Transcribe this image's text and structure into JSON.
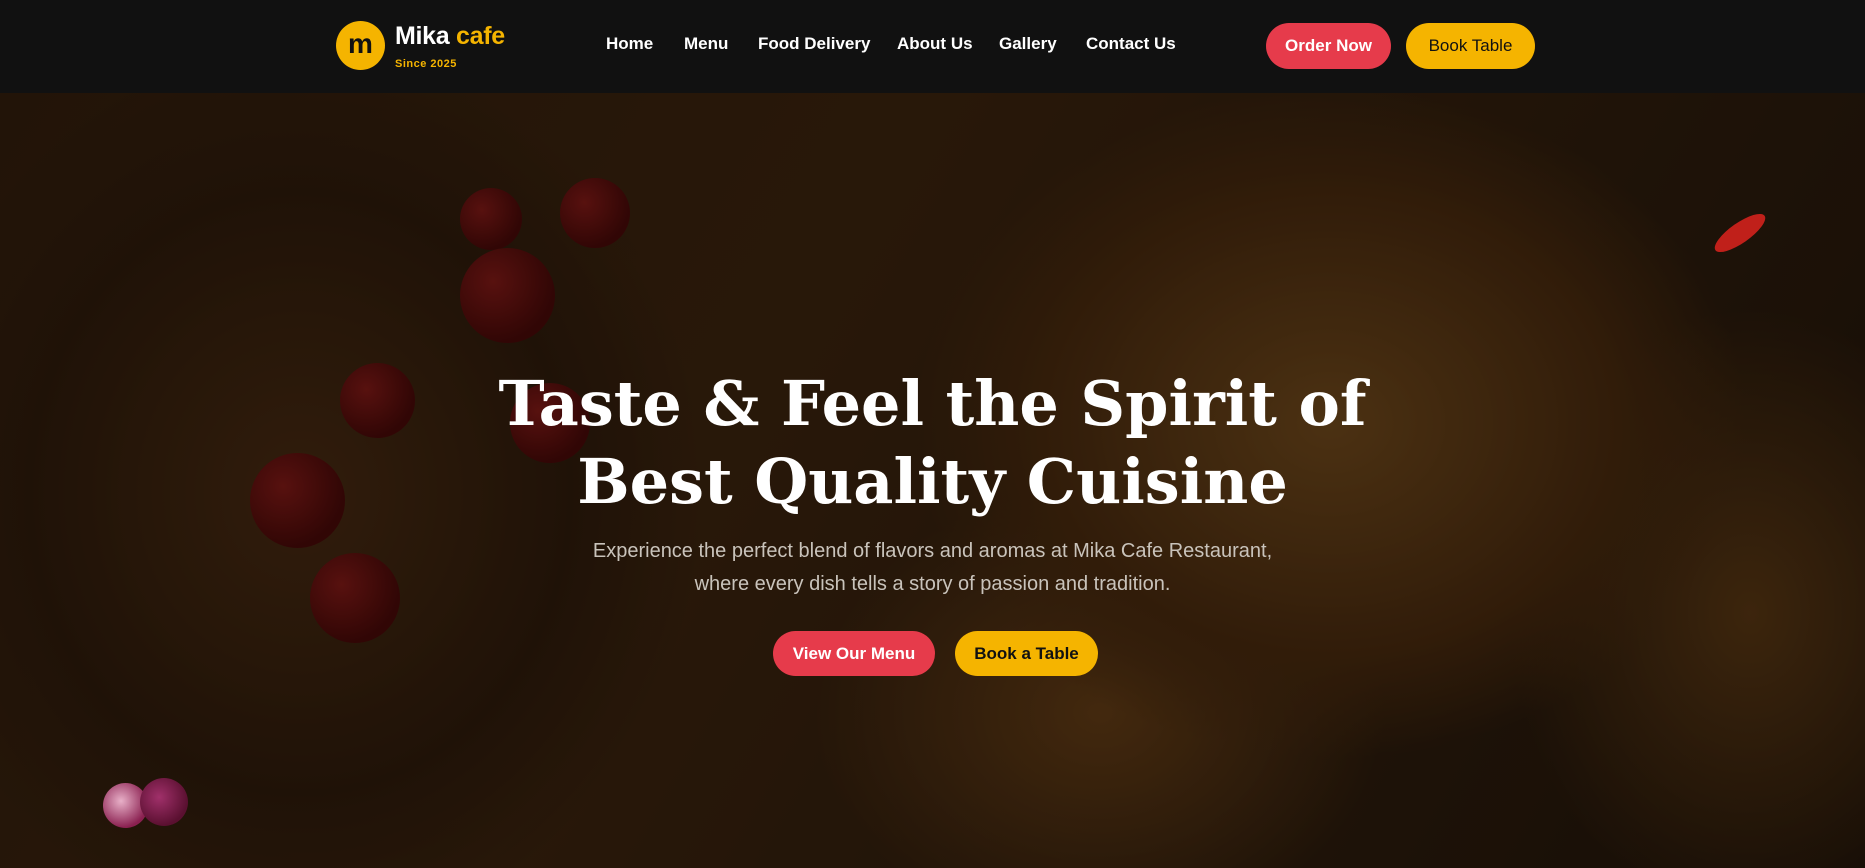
{
  "header": {
    "logo_letter": "m",
    "brand_name": "Mika",
    "brand_accent": "cafe",
    "tagline": "Since 2025",
    "nav": [
      "Home",
      "Menu",
      "Food Delivery",
      "About Us",
      "Gallery",
      "Contact Us"
    ],
    "order_now": "Order Now",
    "book_table": "Book Table"
  },
  "hero": {
    "title_line1": "Taste & Feel the Spirit of",
    "title_line2": "Best Quality Cuisine",
    "subtitle_line1": "Experience the perfect blend of flavors and aromas at Mika Cafe Restaurant,",
    "subtitle_line2": "where every dish tells a story of passion and tradition.",
    "view_menu": "View Our Menu",
    "book_a_table": "Book a Table"
  },
  "colors": {
    "accent_red": "#e63b4b",
    "accent_yellow": "#f5b400",
    "header_bg": "#111111"
  }
}
